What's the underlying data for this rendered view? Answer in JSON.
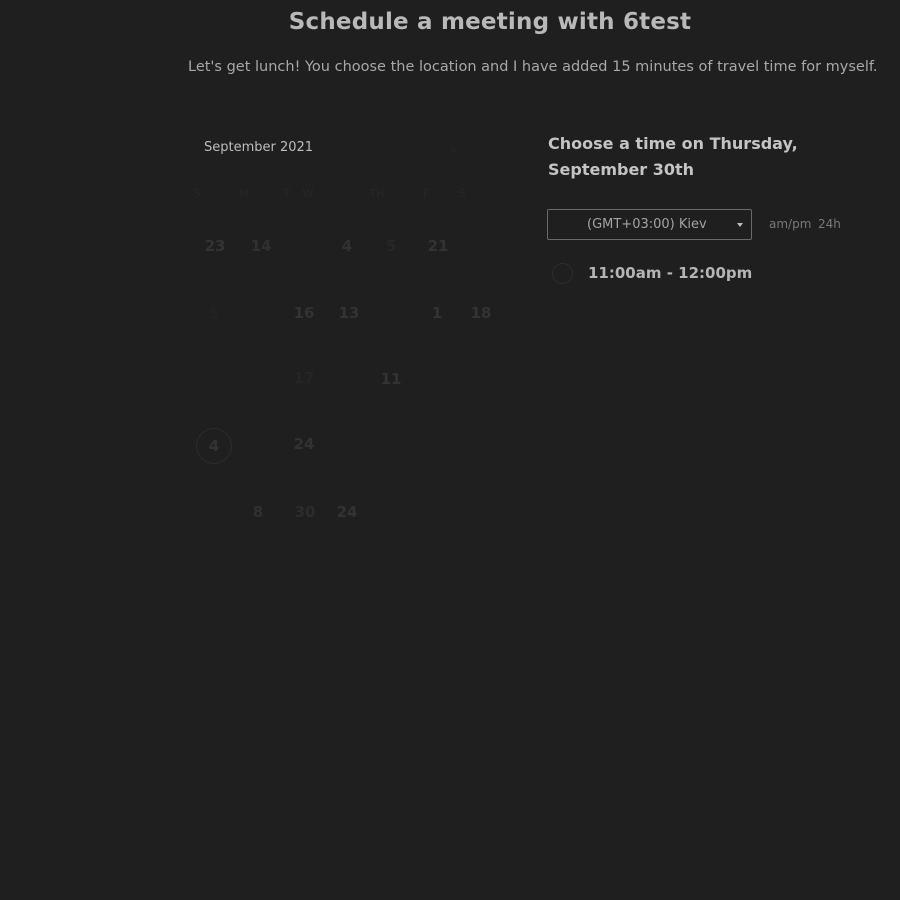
{
  "header": {
    "title": "Schedule a meeting with 6test",
    "subtitle": "Let's get lunch! You choose the location and I have added 15 minutes of travel time for myself."
  },
  "calendar": {
    "month_label": "September 2021",
    "next_icon": "chevron-double-right-icon",
    "weekdays": [
      "S",
      "M",
      "T",
      "W",
      "TH",
      "F",
      "S"
    ],
    "days": [
      {
        "label": "23"
      },
      {
        "label": "14"
      },
      {
        "label": "4"
      },
      {
        "label": "5"
      },
      {
        "label": "21"
      },
      {
        "label": "5"
      },
      {
        "label": "16"
      },
      {
        "label": "13"
      },
      {
        "label": "1"
      },
      {
        "label": "18"
      },
      {
        "label": "17"
      },
      {
        "label": "11"
      },
      {
        "label": "24"
      },
      {
        "label": "8"
      },
      {
        "label": "30"
      },
      {
        "label": "24"
      }
    ],
    "selected_day": "4"
  },
  "time_panel": {
    "heading": "Choose a time on Thursday, September 30th",
    "timezone": "(GMT+03:00) Kiev",
    "format_ampm": "am/pm",
    "format_24h": "24h",
    "slots": [
      {
        "label": "11:00am - 12:00pm"
      }
    ]
  },
  "colors": {
    "background": "#1f1f1f"
  }
}
